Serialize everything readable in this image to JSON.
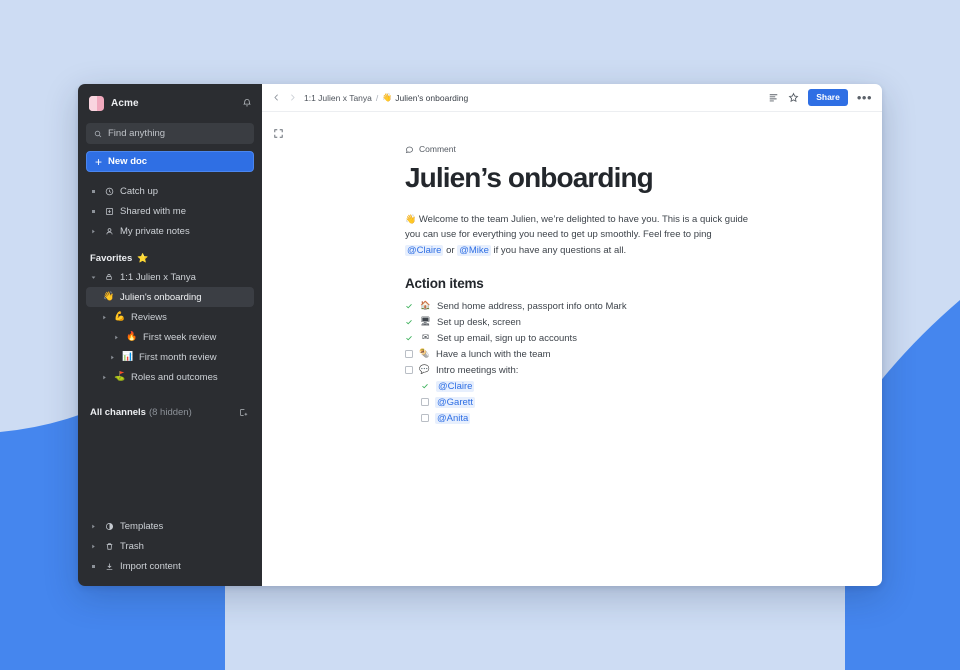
{
  "background": {
    "base_color": "#cddcf3",
    "accent_color": "#4586ee"
  },
  "sidebar": {
    "brand": {
      "name": "Acme",
      "logo_color": "#f0a9bd",
      "bell_icon": "bell-icon"
    },
    "search": {
      "placeholder": "Find anything",
      "icon": "search-icon"
    },
    "new_doc": {
      "label": "New doc",
      "icon": "plus-icon",
      "color": "#2f6fe4"
    },
    "nav": [
      {
        "label": "Catch up",
        "icon": "clock-icon",
        "marker": "dot"
      },
      {
        "label": "Shared with me",
        "icon": "inbox-download-icon",
        "marker": "dot"
      },
      {
        "label": "My private notes",
        "icon": "person-icon",
        "marker": "triangle"
      }
    ],
    "favorites": {
      "label": "Favorites",
      "emoji": "⭐"
    },
    "tree": [
      {
        "label": "1:1 Julien x Tanya",
        "icon": "lock-icon",
        "marker": "triangle-open",
        "indent": 0,
        "selected": false
      },
      {
        "label": "Julien's onboarding",
        "emoji": "👋",
        "marker": "none",
        "indent": 1,
        "selected": true
      },
      {
        "label": "Reviews",
        "emoji": "💪",
        "marker": "triangle",
        "indent": 1,
        "selected": false
      },
      {
        "label": "First week review",
        "emoji": "🔥",
        "marker": "triangle",
        "indent": 2,
        "selected": false
      },
      {
        "label": "First month review",
        "emoji": "📊",
        "marker": "triangle",
        "indent": 2,
        "selected": false
      },
      {
        "label": "Roles and outcomes",
        "emoji": "⛳",
        "marker": "triangle",
        "indent": 1,
        "selected": false
      }
    ],
    "all_channels": {
      "label": "All channels",
      "hidden_note": "(8 hidden)",
      "add_icon": "add-channel-icon"
    },
    "bottom": [
      {
        "label": "Templates",
        "icon": "templates-icon",
        "marker": "triangle"
      },
      {
        "label": "Trash",
        "icon": "trash-icon",
        "marker": "triangle"
      },
      {
        "label": "Import content",
        "icon": "import-icon",
        "marker": "dot"
      }
    ]
  },
  "topbar": {
    "back_icon": "chevron-left-icon",
    "forward_icon": "chevron-right-icon",
    "breadcrumb_parent": "1:1 Julien x Tanya",
    "breadcrumb_sep": "/",
    "breadcrumb_doc_emoji": "👋",
    "breadcrumb_doc": "Julien's onboarding",
    "outline_icon": "outline-icon",
    "star_icon": "star-icon",
    "share_label": "Share",
    "more_icon": "more-horizontal-icon",
    "expand_icon": "expand-icon"
  },
  "document": {
    "comment_label": "Comment",
    "title": "Julien’s onboarding",
    "intro_emoji": "👋",
    "intro_part1": "Welcome to the team Julien, we’re delighted to have you. This is a quick guide you can use for everything you need to get up smoothly. Feel free to ping ",
    "mention_claire": "@Claire",
    "intro_or": " or ",
    "mention_mike": "@Mike",
    "intro_part2": " if you have any questions at all.",
    "section_title": "Action items",
    "tasks": [
      {
        "checked": true,
        "emoji": "🏠",
        "text": "Send home address, passport info onto Mark",
        "sub": false
      },
      {
        "checked": true,
        "emoji": "🖥",
        "text": "Set up desk, screen",
        "sub": false
      },
      {
        "checked": true,
        "emoji": "✉",
        "text": "Set up email, sign up to accounts",
        "sub": false
      },
      {
        "checked": false,
        "emoji": "🌯",
        "text": "Have a lunch with the team",
        "sub": false
      },
      {
        "checked": false,
        "emoji": "💬",
        "text": "Intro meetings with:",
        "sub": false
      },
      {
        "checked": true,
        "emoji": "",
        "text": "@Claire",
        "sub": true,
        "mention": true
      },
      {
        "checked": false,
        "emoji": "",
        "text": "@Garett",
        "sub": true,
        "mention": true
      },
      {
        "checked": false,
        "emoji": "",
        "text": "@Anita",
        "sub": true,
        "mention": true
      }
    ]
  }
}
